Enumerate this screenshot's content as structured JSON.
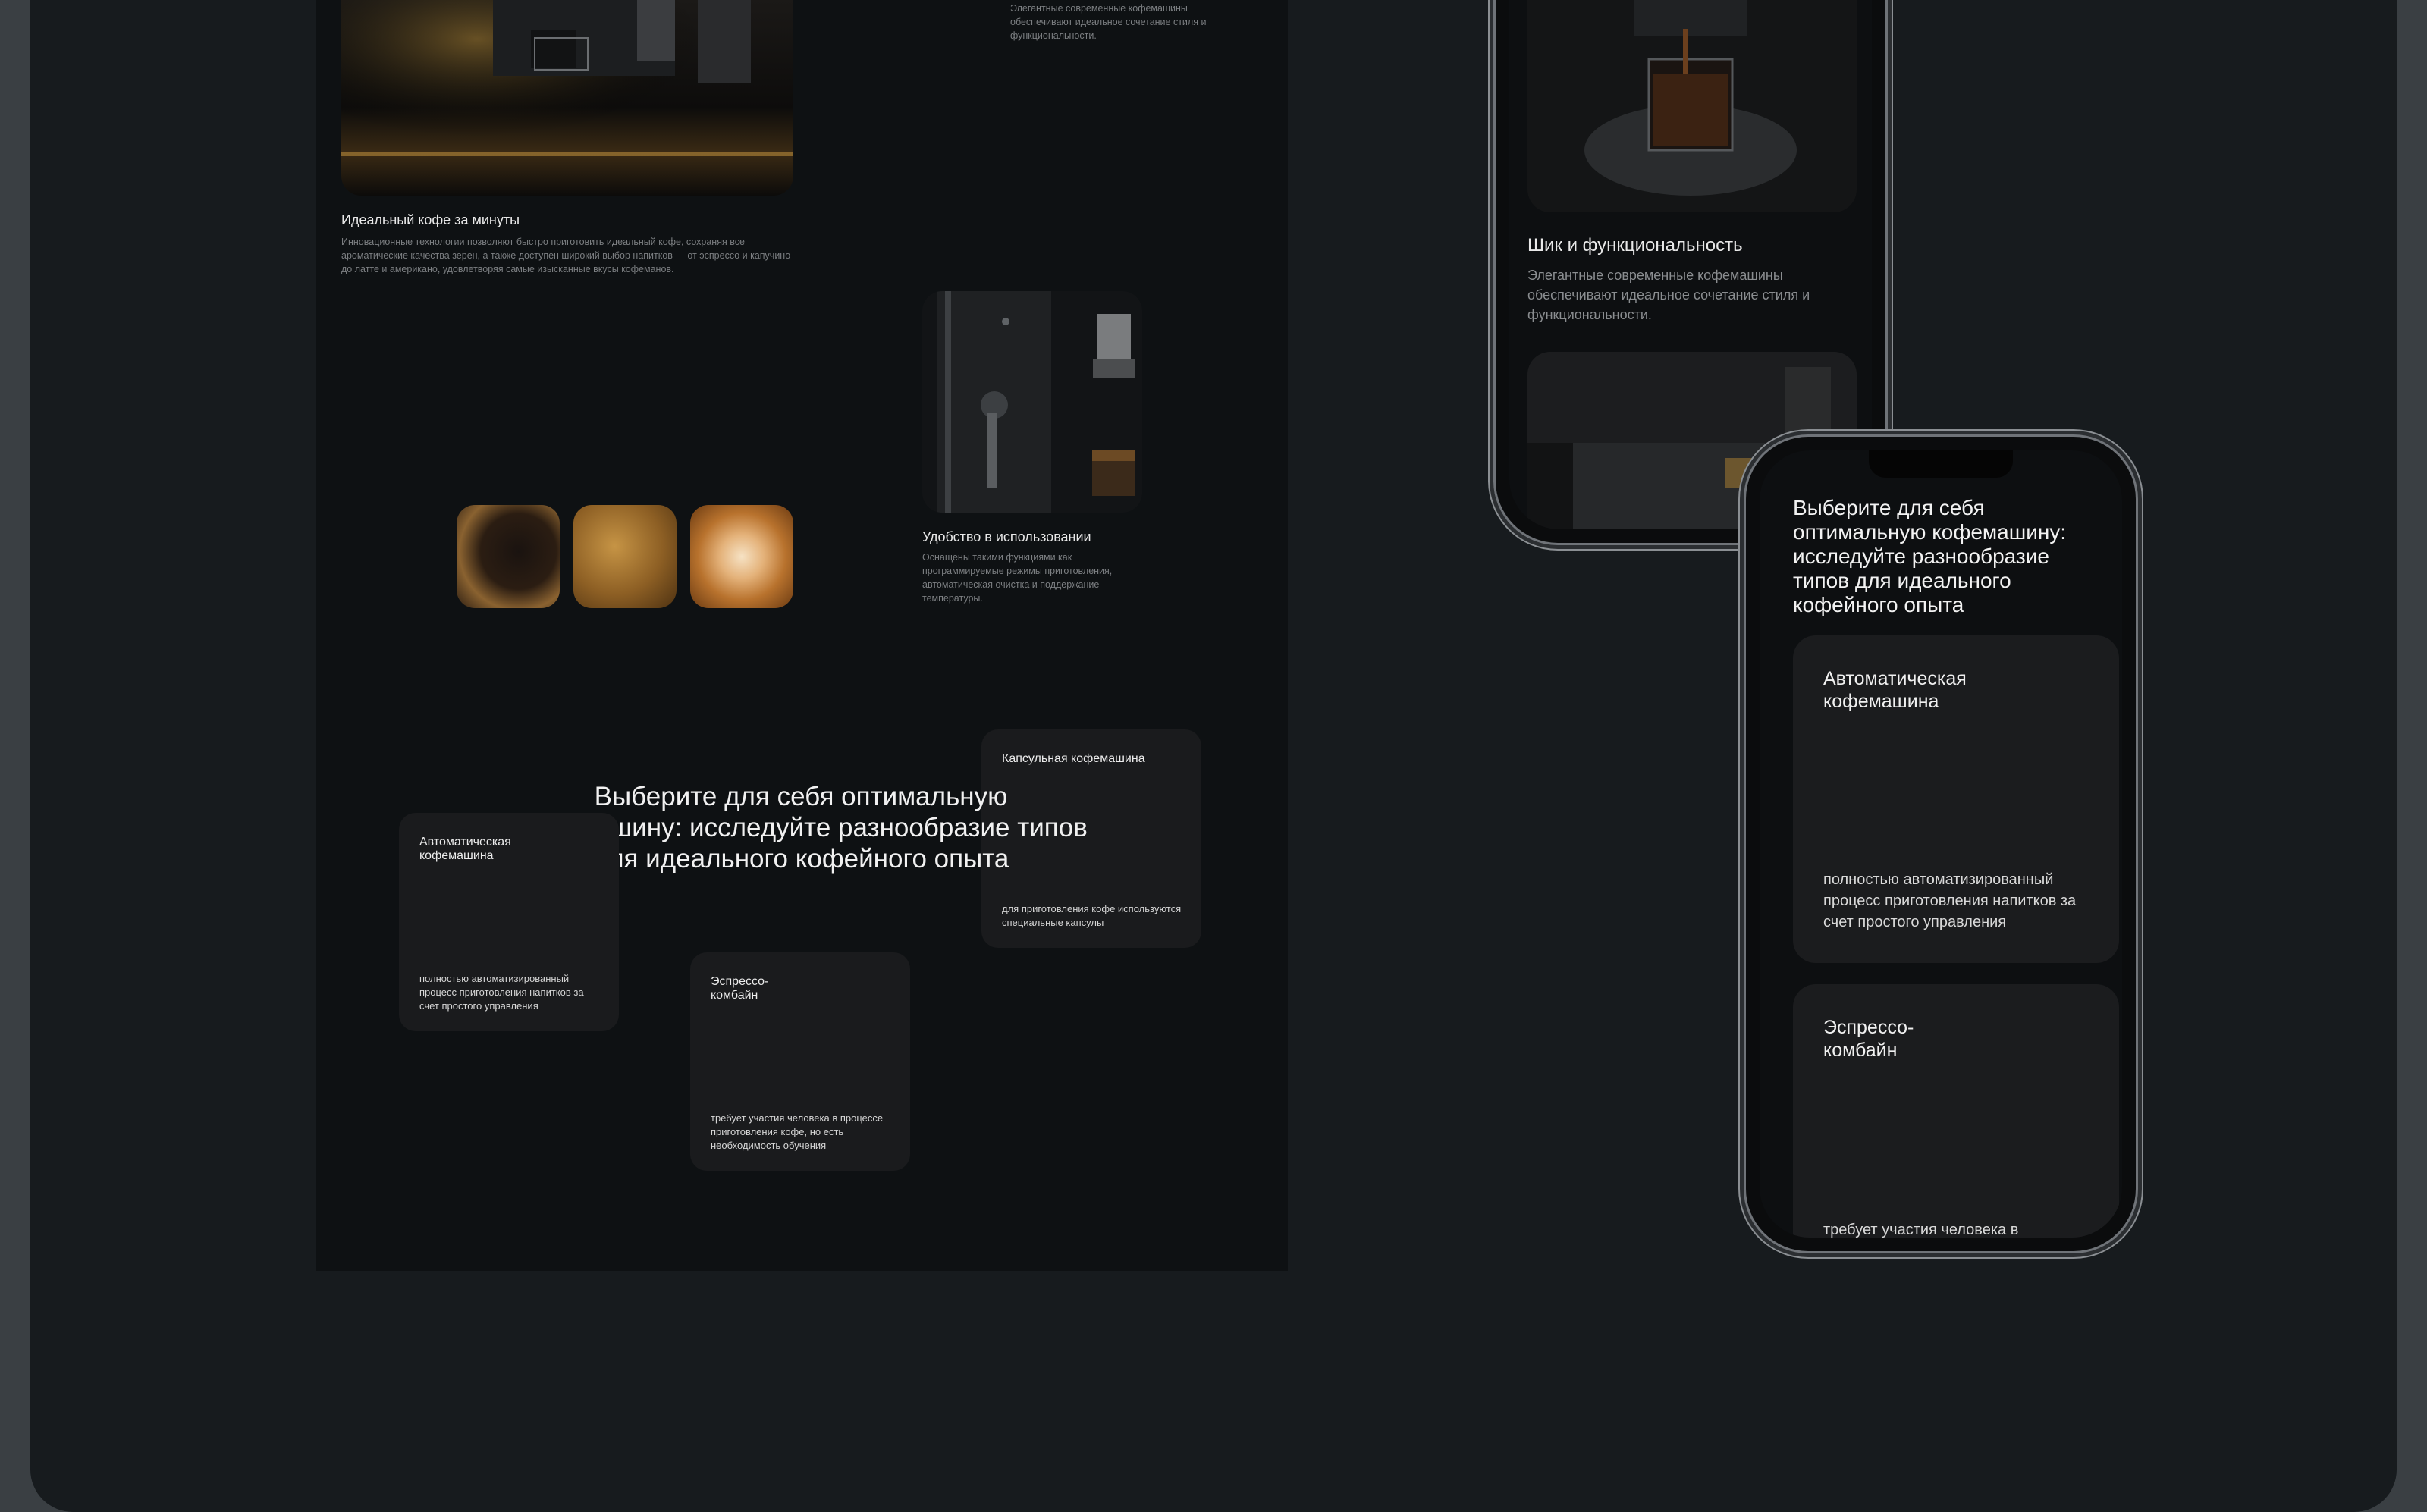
{
  "desktop": {
    "top_right_caption_lines": "Элегантные современные кофемашины обеспечивают идеальное сочетание стиля и функциональности.",
    "section1": {
      "title": "Идеальный кофе за минуты",
      "text": "Инновационные технологии позволяют быстро приготовить идеальный кофе, сохраняя все ароматические качества зерен, а также доступен широкий выбор напитков — от эспрессо и капучино до латте и американо, удовлетворяя самые изысканные вкусы кофеманов."
    },
    "section2": {
      "title": "Удобство в использовании",
      "text": "Оснащены такими функциями как программируемые режимы приготовления, автоматическая очистка и поддержание температуры."
    },
    "heading": "Выберите для себя оптимальную кофемашину: исследуйте разнообразие типов для идеального кофейного опыта",
    "cards": [
      {
        "title": "Капсульная кофемашина",
        "text": "для приготовления кофе используются специальные капсулы"
      },
      {
        "title": "Автоматическая кофемашина",
        "text": "полностью автоматизированный процесс приготовления напитков за счет простого управления"
      },
      {
        "title": "Эспрессо-комбайн",
        "text": "требует участия человека в процессе приготовления кофе, но есть необходимость обучения"
      }
    ]
  },
  "phone1": {
    "title": "Шик и функциональность",
    "text": "Элегантные современные кофемашины обеспечивают идеальное сочетание стиля и функциональности."
  },
  "phone2": {
    "heading": "Выберите для себя оптимальную кофемашину: исследуйте разнообразие типов для идеального кофейного опыта",
    "cards": [
      {
        "title": "Автоматическая кофемашина",
        "text": "полностью автоматизированный процесс приготовления напитков за счет простого управления"
      },
      {
        "title": "Эспрессо-комбайн",
        "text": "требует участия человека в"
      }
    ]
  }
}
